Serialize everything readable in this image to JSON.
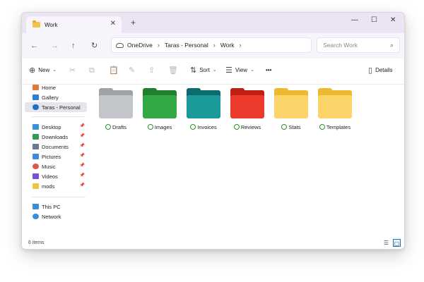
{
  "window": {
    "tab_title": "Work",
    "tab_close": "✕",
    "new_tab": "+",
    "minimize": "—",
    "maximize": "☐",
    "close": "✕"
  },
  "nav": {
    "back": "←",
    "forward": "→",
    "up": "↑",
    "refresh": "↻",
    "breadcrumb": [
      "OneDrive",
      "Taras - Personal",
      "Work"
    ],
    "breadcrumb_sep": "›",
    "search_placeholder": "Search Work",
    "search_icon": "⌕"
  },
  "toolbar": {
    "new_icon": "⊕",
    "new_label": "New",
    "cut_icon": "✂",
    "copy_icon": "⧉",
    "paste_icon": "📋",
    "rename_icon": "✎",
    "share_icon": "⇪",
    "delete_icon": "🗑",
    "sort_icon": "⇅",
    "sort_label": "Sort",
    "view_icon": "☰",
    "view_label": "View",
    "caret": "⌄",
    "more_label": "•••",
    "details_icon": "▯",
    "details_label": "Details"
  },
  "sidebar": {
    "top": [
      {
        "label": "Home",
        "icon": "home-icon",
        "color": "#e07a3c"
      },
      {
        "label": "Gallery",
        "icon": "gallery-icon",
        "color": "#2d7fd3"
      },
      {
        "label": "Taras - Personal",
        "icon": "onedrive-icon",
        "color": "#1f6fc5",
        "active": true
      }
    ],
    "quick_access": [
      {
        "label": "Desktop",
        "icon": "desktop-icon",
        "color": "#3a8fd9"
      },
      {
        "label": "Downloads",
        "icon": "downloads-icon",
        "color": "#2e9e57"
      },
      {
        "label": "Documents",
        "icon": "documents-icon",
        "color": "#6a7b8c"
      },
      {
        "label": "Pictures",
        "icon": "pictures-icon",
        "color": "#3d8be0"
      },
      {
        "label": "Music",
        "icon": "music-icon",
        "color": "#e0574a"
      },
      {
        "label": "Videos",
        "icon": "videos-icon",
        "color": "#7a4fd0"
      },
      {
        "label": "mods",
        "icon": "folder-icon",
        "color": "#f3c24b"
      }
    ],
    "pin": "📌",
    "devices": [
      {
        "label": "This PC",
        "icon": "this-pc-icon",
        "color": "#3a8fd9"
      },
      {
        "label": "Network",
        "icon": "network-icon",
        "color": "#3a8fd9"
      }
    ]
  },
  "folders": [
    {
      "label": "Drafts",
      "back": "#9fa3a8",
      "front": "#c2c5c9"
    },
    {
      "label": "Images",
      "back": "#1f7f2f",
      "front": "#34a845"
    },
    {
      "label": "Invoices",
      "back": "#0d6b6e",
      "front": "#1b9a9c"
    },
    {
      "label": "Reviews",
      "back": "#c01f14",
      "front": "#ec3b2d"
    },
    {
      "label": "Stats",
      "back": "#efb92f",
      "front": "#fbd56a"
    },
    {
      "label": "Templates",
      "back": "#efb92f",
      "front": "#fbd56a"
    }
  ],
  "status": {
    "count": "6 items",
    "list_view_icon": "☰",
    "tile_view_icon": "▢"
  }
}
